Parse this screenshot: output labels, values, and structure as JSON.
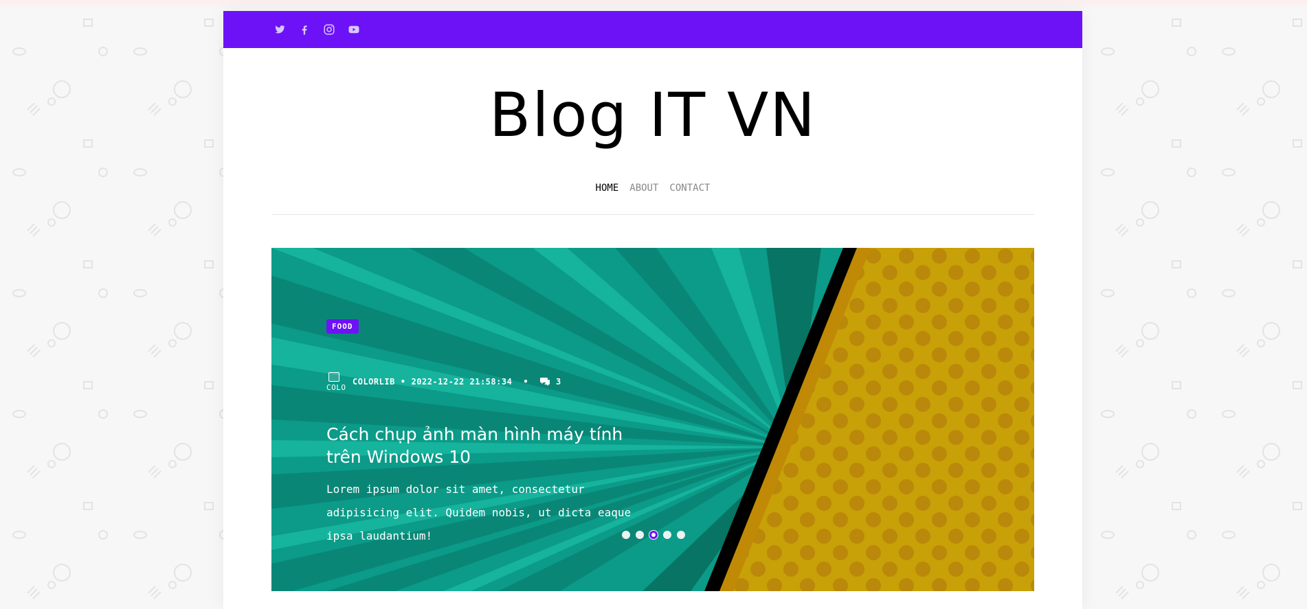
{
  "social": [
    {
      "icon": "twitter-icon"
    },
    {
      "icon": "facebook-icon"
    },
    {
      "icon": "instagram-icon"
    },
    {
      "icon": "youtube-icon"
    }
  ],
  "colors": {
    "brand": "#6d12f6",
    "hero_teal": "#0b9b88",
    "hero_yellow": "#c8a007",
    "dots": "#b8840a"
  },
  "site": {
    "title": "Blog IT VN"
  },
  "nav": [
    {
      "label": "HOME",
      "active": true
    },
    {
      "label": "ABOUT",
      "active": false
    },
    {
      "label": "CONTACT",
      "active": false
    }
  ],
  "hero": {
    "category": "FOOD",
    "avatar_alt": "COLO",
    "author": "COLORLIB",
    "bullet": "•",
    "datetime": "2022-12-22 21:58:34",
    "comments_count": "3",
    "title": "Cách chụp ảnh màn hình máy tính trên Windows 10",
    "excerpt": "Lorem ipsum dolor sit amet, consectetur adipisicing elit. Quidem nobis, ut dicta eaque ipsa laudantium!",
    "slider": {
      "count": 5,
      "active_index": 2
    }
  }
}
